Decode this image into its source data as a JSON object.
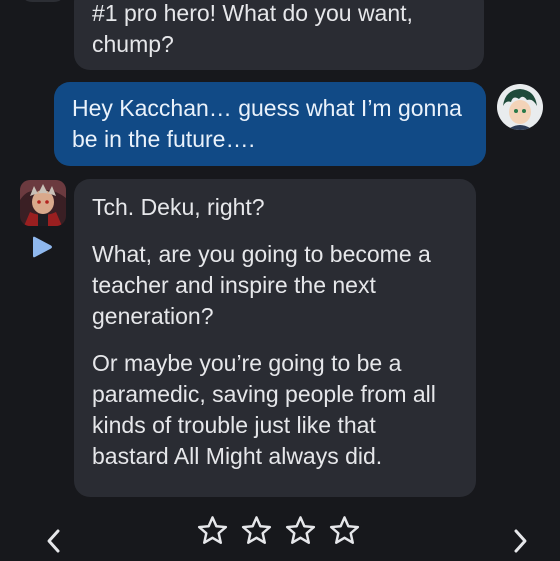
{
  "messages": [
    {
      "role": "bot",
      "paragraphs": [
        "#1 pro hero! What do you want, chump?"
      ]
    },
    {
      "role": "user",
      "paragraphs": [
        "Hey Kacchan… guess what I’m gonna be in the future…."
      ]
    },
    {
      "role": "bot",
      "paragraphs": [
        "Tch. Deku, right?",
        "What, are you going to become a teacher and inspire the next generation?",
        "Or maybe you’re going to be a paramedic, saving people from all kinds of trouble just like that bastard All Might always did."
      ]
    }
  ],
  "rating": {
    "max": 4,
    "value": 0
  },
  "icons": {
    "play": "play-icon",
    "star": "star-outline-icon",
    "prev": "chevron-left-icon",
    "next": "chevron-right-icon"
  },
  "colors": {
    "background": "#17181c",
    "bot_bubble": "#2a2c33",
    "user_bubble": "#114a86",
    "play_accent": "#8fb8ee",
    "text": "#e6e7ea"
  }
}
